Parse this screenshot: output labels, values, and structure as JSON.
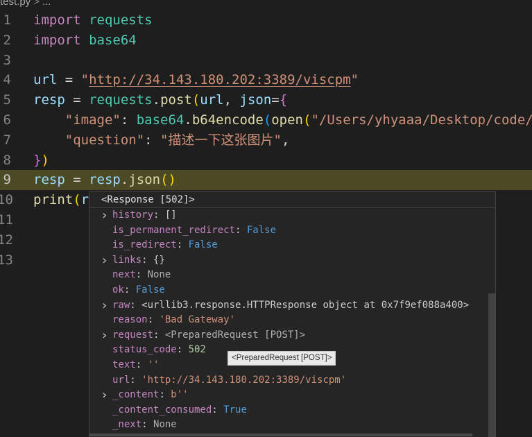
{
  "breadcrumb": {
    "file": "test.py",
    "sep": ">",
    "more": "..."
  },
  "lines": [
    {
      "n": "1",
      "tokens": [
        [
          "kw",
          "import"
        ],
        [
          "op",
          " "
        ],
        [
          "mod",
          "requests"
        ]
      ]
    },
    {
      "n": "2",
      "tokens": [
        [
          "kw",
          "import"
        ],
        [
          "op",
          " "
        ],
        [
          "mod",
          "base64"
        ]
      ]
    },
    {
      "n": "3",
      "tokens": []
    },
    {
      "n": "4",
      "tokens": [
        [
          "var",
          "url"
        ],
        [
          "op",
          " = "
        ],
        [
          "str",
          "\""
        ],
        [
          "url",
          "http://34.143.180.202:3389/viscpm"
        ],
        [
          "str",
          "\""
        ]
      ]
    },
    {
      "n": "5",
      "tokens": [
        [
          "var",
          "resp"
        ],
        [
          "op",
          " = "
        ],
        [
          "mod",
          "requests"
        ],
        [
          "op",
          "."
        ],
        [
          "fn",
          "post"
        ],
        [
          "br1",
          "("
        ],
        [
          "var",
          "url"
        ],
        [
          "op",
          ", "
        ],
        [
          "var",
          "json"
        ],
        [
          "op",
          "="
        ],
        [
          "br2",
          "{"
        ]
      ]
    },
    {
      "n": "6",
      "tokens": [
        [
          "op",
          "    "
        ],
        [
          "str",
          "\"image\""
        ],
        [
          "op",
          ": "
        ],
        [
          "mod",
          "base64"
        ],
        [
          "op",
          "."
        ],
        [
          "fn",
          "b64encode"
        ],
        [
          "br3",
          "("
        ],
        [
          "fn",
          "open"
        ],
        [
          "br1",
          "("
        ],
        [
          "str",
          "\"/Users/yhyaaa/Desktop/code/"
        ]
      ]
    },
    {
      "n": "7",
      "tokens": [
        [
          "op",
          "    "
        ],
        [
          "str",
          "\"question\""
        ],
        [
          "op",
          ": "
        ],
        [
          "str",
          "\"描述一下这张图片\""
        ],
        [
          "op",
          ","
        ]
      ]
    },
    {
      "n": "8",
      "tokens": [
        [
          "br2",
          "}"
        ],
        [
          "br1",
          ")"
        ]
      ]
    },
    {
      "n": "9",
      "tokens": [
        [
          "var",
          "resp"
        ],
        [
          "op",
          " = "
        ],
        [
          "var",
          "resp"
        ],
        [
          "op",
          "."
        ],
        [
          "fn",
          "json"
        ],
        [
          "br1",
          "()"
        ]
      ]
    },
    {
      "n": "10",
      "tokens": [
        [
          "fn",
          "print"
        ],
        [
          "br1",
          "("
        ],
        [
          "var",
          "r"
        ]
      ]
    },
    {
      "n": "11",
      "tokens": []
    },
    {
      "n": "12",
      "tokens": []
    },
    {
      "n": "13",
      "tokens": []
    }
  ],
  "hover": {
    "title": "<Response [502]>",
    "rows": [
      {
        "expandable": true,
        "key": "history",
        "value": "[]",
        "vclass": "v-obj"
      },
      {
        "expandable": false,
        "key": "is_permanent_redirect",
        "value": "False",
        "vclass": "v-bool"
      },
      {
        "expandable": false,
        "key": "is_redirect",
        "value": "False",
        "vclass": "v-bool"
      },
      {
        "expandable": true,
        "key": "links",
        "value": "{}",
        "vclass": "v-obj"
      },
      {
        "expandable": false,
        "key": "next",
        "value": "None",
        "vclass": "v-none"
      },
      {
        "expandable": false,
        "key": "ok",
        "value": "False",
        "vclass": "v-bool"
      },
      {
        "expandable": true,
        "key": "raw",
        "value": "<urllib3.response.HTTPResponse object at 0x7f9ef088a400>",
        "vclass": "v-obj"
      },
      {
        "expandable": false,
        "key": "reason",
        "value": "'Bad Gateway'",
        "vclass": "v-str"
      },
      {
        "expandable": true,
        "key": "request",
        "value": "<PreparedRequest [POST]>",
        "vclass": "v-none"
      },
      {
        "expandable": false,
        "key": "status_code",
        "value": "502",
        "vclass": "v-num"
      },
      {
        "expandable": false,
        "key": "text",
        "value": "''",
        "vclass": "v-str"
      },
      {
        "expandable": false,
        "key": "url",
        "value": "'http://34.143.180.202:3389/viscpm'",
        "vclass": "v-str"
      },
      {
        "expandable": true,
        "key": "_content",
        "value": "b''",
        "vclass": "v-str"
      },
      {
        "expandable": false,
        "key": "_content_consumed",
        "value": "True",
        "vclass": "v-bool"
      },
      {
        "expandable": false,
        "key": "_next",
        "value": "None",
        "vclass": "v-none"
      }
    ]
  },
  "tooltip": "<PreparedRequest [POST]>"
}
